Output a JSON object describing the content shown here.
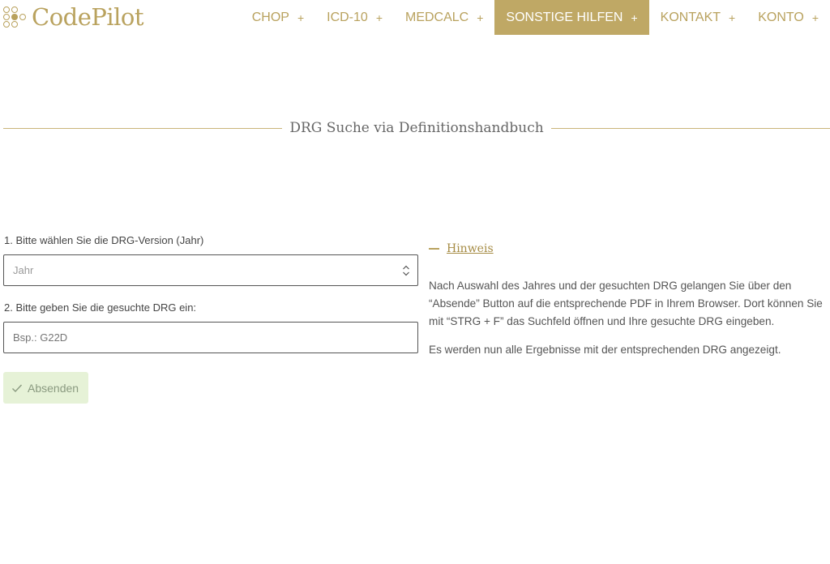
{
  "brand": {
    "name": "CodePilot",
    "color": "#b9a25e",
    "active_nav_bg": "#bfa865"
  },
  "nav": {
    "items": [
      {
        "label": "CHOP",
        "plus": "+",
        "active": false
      },
      {
        "label": "ICD-10",
        "plus": "+",
        "active": false
      },
      {
        "label": "MEDCALC",
        "plus": "+",
        "active": false
      },
      {
        "label": "SONSTIGE HILFEN",
        "plus": "+",
        "active": true
      },
      {
        "label": "KONTAKT",
        "plus": "+",
        "active": false
      },
      {
        "label": "KONTO",
        "plus": "+",
        "active": false
      }
    ]
  },
  "page": {
    "title": "DRG Suche via Definitionshandbuch"
  },
  "form": {
    "step1_label": "1. Bitte wählen Sie die DRG-Version (Jahr)",
    "year_select_value": "Jahr",
    "step2_label": "2. Bitte geben Sie die gesuchte DRG ein:",
    "drg_placeholder": "Bsp.: G22D",
    "drg_value": "",
    "submit_label": "Absenden",
    "submit_icon": "check-icon"
  },
  "hint": {
    "title": "Hinweis",
    "paragraph1": "Nach Auswahl des Jahres und der gesuchten DRG gelangen Sie über den “Absende” Button auf die entsprechende PDF in Ihrem Browser. Dort können Sie mit “STRG + F” das Suchfeld öffnen und Ihre gesuchte DRG eingeben.",
    "paragraph2": "Es werden nun alle Ergebnisse mit der entsprechenden DRG angezeigt."
  }
}
